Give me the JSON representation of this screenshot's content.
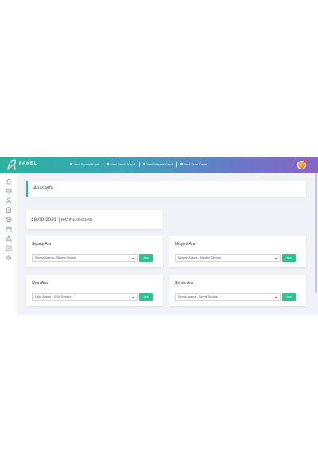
{
  "header": {
    "brand": "PANEL",
    "quick_links": [
      {
        "label": "Yeni Sipariş Kaydı"
      },
      {
        "label": "Yeni Servis Kaydı"
      },
      {
        "label": "Yeni Müşteri Kaydı"
      },
      {
        "label": "Yeni Ürün Kaydı"
      }
    ],
    "accent_colors": [
      "#2bb3a0",
      "#8a64c6"
    ]
  },
  "sidebar": {
    "icons": [
      "home-icon",
      "database-icon",
      "user-icon",
      "clipboard-icon",
      "cube-icon",
      "calendar-icon",
      "warning-icon",
      "list-icon",
      "gear-icon"
    ]
  },
  "page": {
    "title": "Anasayfa"
  },
  "reminders": {
    "date": "18.09.2021",
    "separator": "|",
    "label": "HATIRLATICILAR"
  },
  "search_cards": [
    {
      "title": "Sipariş Ara",
      "select_value": "Sipariş Arama - Sipariş Seçiniz",
      "button": "Ara"
    },
    {
      "title": "Müşteri Ara",
      "select_value": "Müşteri Arama - Müşteri Seçiniz",
      "button": "Ara"
    },
    {
      "title": "Ürün Ara",
      "select_value": "Ürün Arama - Ürün Seçiniz",
      "button": "Ara"
    },
    {
      "title": "Servis Ara",
      "select_value": "Servis Arama - Servis Seçiniz",
      "button": "Ara"
    }
  ],
  "button_color": "#2ec28f"
}
